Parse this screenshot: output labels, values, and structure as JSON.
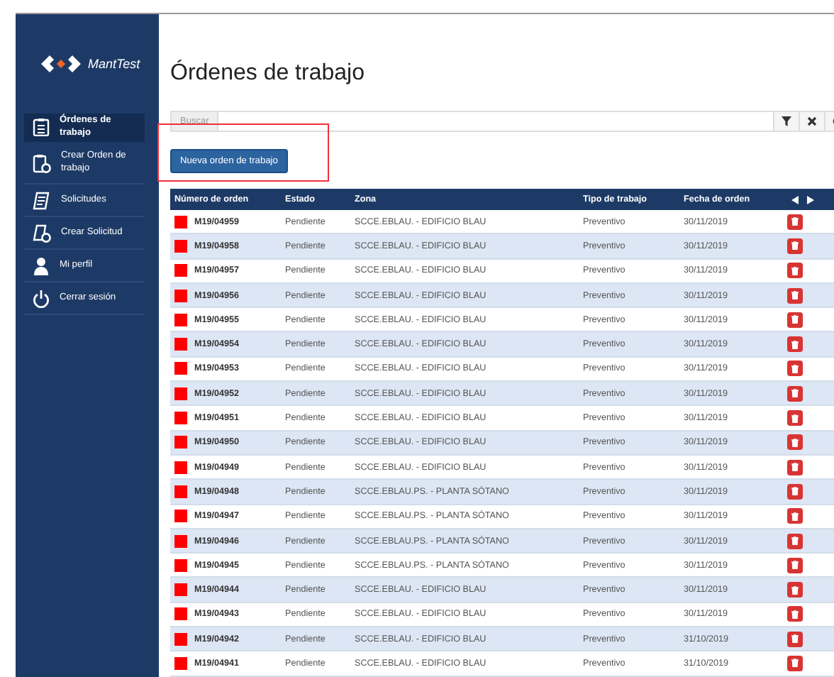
{
  "logo": {
    "text": "MantTest"
  },
  "sidebar": {
    "items": [
      {
        "label": "Órdenes de trabajo",
        "selected": true
      },
      {
        "label": "Crear Orden de trabajo",
        "selected": false
      },
      {
        "label": "Solicitudes",
        "selected": false
      },
      {
        "label": "Crear Solicitud",
        "selected": false
      },
      {
        "label": "Mi perfil",
        "selected": false
      },
      {
        "label": "Cerrar sesión",
        "selected": false
      }
    ]
  },
  "page": {
    "title": "Órdenes de trabajo"
  },
  "search": {
    "label": "Buscar"
  },
  "new_button": {
    "label": "Nueva orden de trabajo"
  },
  "table": {
    "columns": [
      "Número de orden",
      "Estado",
      "Zona",
      "Tipo de trabajo",
      "Fecha de orden"
    ],
    "rows": [
      {
        "number": "M19/04959",
        "status": "Pendiente",
        "zone": "SCCE.EBLAU. - EDIFICIO BLAU",
        "type": "Preventivo",
        "date": "30/11/2019",
        "color": "#ff0000"
      },
      {
        "number": "M19/04958",
        "status": "Pendiente",
        "zone": "SCCE.EBLAU. - EDIFICIO BLAU",
        "type": "Preventivo",
        "date": "30/11/2019",
        "color": "#ff0000"
      },
      {
        "number": "M19/04957",
        "status": "Pendiente",
        "zone": "SCCE.EBLAU. - EDIFICIO BLAU",
        "type": "Preventivo",
        "date": "30/11/2019",
        "color": "#ff0000"
      },
      {
        "number": "M19/04956",
        "status": "Pendiente",
        "zone": "SCCE.EBLAU. - EDIFICIO BLAU",
        "type": "Preventivo",
        "date": "30/11/2019",
        "color": "#ff0000"
      },
      {
        "number": "M19/04955",
        "status": "Pendiente",
        "zone": "SCCE.EBLAU. - EDIFICIO BLAU",
        "type": "Preventivo",
        "date": "30/11/2019",
        "color": "#ff0000"
      },
      {
        "number": "M19/04954",
        "status": "Pendiente",
        "zone": "SCCE.EBLAU. - EDIFICIO BLAU",
        "type": "Preventivo",
        "date": "30/11/2019",
        "color": "#ff0000"
      },
      {
        "number": "M19/04953",
        "status": "Pendiente",
        "zone": "SCCE.EBLAU. - EDIFICIO BLAU",
        "type": "Preventivo",
        "date": "30/11/2019",
        "color": "#ff0000"
      },
      {
        "number": "M19/04952",
        "status": "Pendiente",
        "zone": "SCCE.EBLAU. - EDIFICIO BLAU",
        "type": "Preventivo",
        "date": "30/11/2019",
        "color": "#ff0000"
      },
      {
        "number": "M19/04951",
        "status": "Pendiente",
        "zone": "SCCE.EBLAU. - EDIFICIO BLAU",
        "type": "Preventivo",
        "date": "30/11/2019",
        "color": "#ff0000"
      },
      {
        "number": "M19/04950",
        "status": "Pendiente",
        "zone": "SCCE.EBLAU. - EDIFICIO BLAU",
        "type": "Preventivo",
        "date": "30/11/2019",
        "color": "#ff0000"
      },
      {
        "number": "M19/04949",
        "status": "Pendiente",
        "zone": "SCCE.EBLAU. - EDIFICIO BLAU",
        "type": "Preventivo",
        "date": "30/11/2019",
        "color": "#ff0000"
      },
      {
        "number": "M19/04948",
        "status": "Pendiente",
        "zone": "SCCE.EBLAU.PS. - PLANTA SÓTANO",
        "type": "Preventivo",
        "date": "30/11/2019",
        "color": "#ff0000"
      },
      {
        "number": "M19/04947",
        "status": "Pendiente",
        "zone": "SCCE.EBLAU.PS. - PLANTA SÓTANO",
        "type": "Preventivo",
        "date": "30/11/2019",
        "color": "#ff0000"
      },
      {
        "number": "M19/04946",
        "status": "Pendiente",
        "zone": "SCCE.EBLAU.PS. - PLANTA SÓTANO",
        "type": "Preventivo",
        "date": "30/11/2019",
        "color": "#ff0000"
      },
      {
        "number": "M19/04945",
        "status": "Pendiente",
        "zone": "SCCE.EBLAU.PS. - PLANTA SÓTANO",
        "type": "Preventivo",
        "date": "30/11/2019",
        "color": "#ff0000"
      },
      {
        "number": "M19/04944",
        "status": "Pendiente",
        "zone": "SCCE.EBLAU. - EDIFICIO BLAU",
        "type": "Preventivo",
        "date": "30/11/2019",
        "color": "#ff0000"
      },
      {
        "number": "M19/04943",
        "status": "Pendiente",
        "zone": "SCCE.EBLAU. - EDIFICIO BLAU",
        "type": "Preventivo",
        "date": "30/11/2019",
        "color": "#ff0000"
      },
      {
        "number": "M19/04942",
        "status": "Pendiente",
        "zone": "SCCE.EBLAU. - EDIFICIO BLAU",
        "type": "Preventivo",
        "date": "31/10/2019",
        "color": "#ff0000"
      },
      {
        "number": "M19/04941",
        "status": "Pendiente",
        "zone": "SCCE.EBLAU. - EDIFICIO BLAU",
        "type": "Preventivo",
        "date": "31/10/2019",
        "color": "#ff0000"
      }
    ]
  }
}
